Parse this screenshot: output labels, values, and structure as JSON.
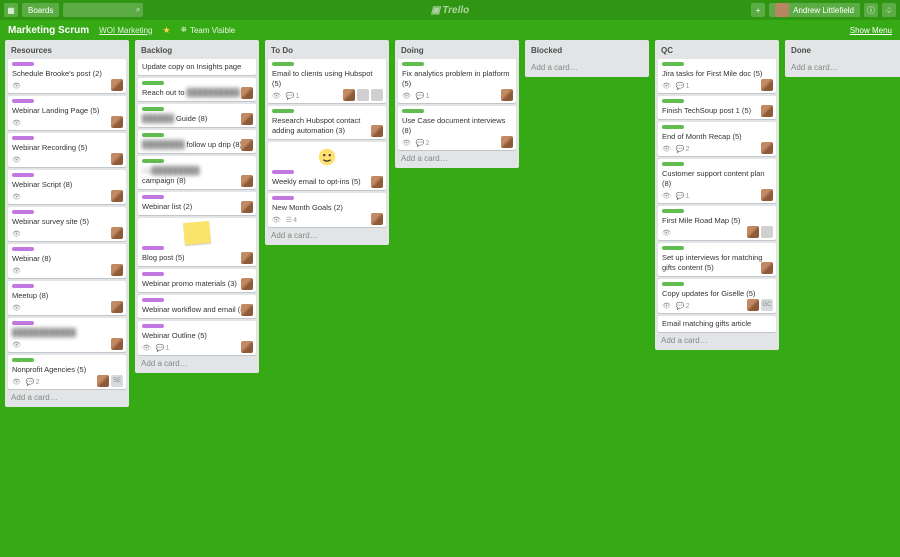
{
  "topbar": {
    "boards_label": "Boards",
    "logo_text": "Trello",
    "user_name": "Andrew Littlefield"
  },
  "board_header": {
    "title": "Marketing Scrum",
    "team": "WOI Marketing",
    "visibility": "Team Visible",
    "show_menu": "Show Menu"
  },
  "add_card_text": "Add a card…",
  "lists": {
    "resources": {
      "name": "Resources",
      "cards": [
        {
          "labels": [
            "purple"
          ],
          "title": "Schedule Brooke's post (2)",
          "watch": true,
          "avatars": [
            "p"
          ]
        },
        {
          "labels": [
            "purple"
          ],
          "title": "Webinar Landing Page (5)",
          "watch": true,
          "avatars": [
            "p"
          ]
        },
        {
          "labels": [
            "purple"
          ],
          "title": "Webinar Recording (5)",
          "watch": true,
          "avatars": [
            "p"
          ]
        },
        {
          "labels": [
            "purple"
          ],
          "title": "Webinar Script (8)",
          "watch": true,
          "avatars": [
            "p"
          ]
        },
        {
          "labels": [
            "purple"
          ],
          "title": "Webinar survey site (5)",
          "watch": true,
          "avatars": [
            "p"
          ]
        },
        {
          "labels": [
            "purple"
          ],
          "title": "Webinar (8)",
          "watch": true,
          "avatars": [
            "p"
          ]
        },
        {
          "labels": [
            "purple"
          ],
          "title": "Meetup (8)",
          "watch": true,
          "avatars": [
            "p"
          ]
        },
        {
          "labels": [
            "purple"
          ],
          "title_blur": true,
          "title": "████████████",
          "watch": true,
          "avatars": [
            "p"
          ]
        },
        {
          "labels": [
            "green"
          ],
          "title": "Nonprofit Agencies (5)",
          "watch": true,
          "comments": 2,
          "avatars": [
            "p",
            "SE"
          ]
        }
      ]
    },
    "backlog": {
      "name": "Backlog",
      "cards": [
        {
          "title": "Update copy on Insights page"
        },
        {
          "labels": [
            "green"
          ],
          "title": "Reach out to ",
          "title_blur_suffix": "██████████",
          "avatars": [
            "p"
          ]
        },
        {
          "labels": [
            "green"
          ],
          "title_blur_prefix": "██████",
          "title": " Guide (8)",
          "avatars": [
            "p"
          ]
        },
        {
          "labels": [
            "green"
          ],
          "title_blur_prefix": "████████",
          "title": " follow up drip (8)",
          "avatars": [
            "p"
          ]
        },
        {
          "labels": [
            "green"
          ],
          "title_blur_prefix": "Ca█████████",
          "title": "",
          "subtitle": "campaign (8)",
          "avatars": [
            "p"
          ]
        },
        {
          "labels": [
            "purple"
          ],
          "title": "Webinar list (2)",
          "avatars": [
            "p"
          ]
        },
        {
          "sticker": "yellow-note",
          "labels": [
            "purple"
          ],
          "title": "Blog post (5)",
          "avatars": [
            "p"
          ]
        },
        {
          "labels": [
            "purple"
          ],
          "title": "Webinar promo materials (3)",
          "avatars": [
            "p"
          ]
        },
        {
          "labels": [
            "purple"
          ],
          "title": "Webinar workflow and email (8)",
          "avatars": [
            "p"
          ]
        },
        {
          "labels": [
            "purple"
          ],
          "title": "Webinar Outline (5)",
          "watch": true,
          "comments": 1,
          "avatars": [
            "p"
          ]
        }
      ]
    },
    "todo": {
      "name": "To Do",
      "cards": [
        {
          "labels": [
            "green"
          ],
          "title": "Email to clients using Hubspot (5)",
          "watch": true,
          "comments": 1,
          "avatars": [
            "p",
            "b",
            "b"
          ]
        },
        {
          "labels": [
            "green"
          ],
          "title": "Research Hubspot contact adding automation (3)",
          "avatars": [
            "p"
          ]
        },
        {
          "sticker": "star-face",
          "labels": [
            "purple"
          ],
          "title": "Weekly email to opt-ins (5)",
          "avatars": [
            "p"
          ]
        },
        {
          "labels": [
            "purple"
          ],
          "title": "New Month Goals (2)",
          "watch": true,
          "extra": 4,
          "avatars": [
            "p"
          ]
        }
      ]
    },
    "doing": {
      "name": "Doing",
      "cards": [
        {
          "labels": [
            "green"
          ],
          "title": "Fix analytics problem in platform (5)",
          "watch": true,
          "comments": 1,
          "avatars": [
            "p"
          ]
        },
        {
          "labels": [
            "green"
          ],
          "title": "Use Case document interviews (8)",
          "watch": true,
          "comments": 2,
          "avatars": [
            "p"
          ]
        }
      ]
    },
    "blocked": {
      "name": "Blocked",
      "cards": []
    },
    "qc": {
      "name": "QC",
      "cards": [
        {
          "labels": [
            "green"
          ],
          "title": "Jira tasks for First Mile doc (5)",
          "watch": true,
          "comments": 1,
          "avatars": [
            "p"
          ]
        },
        {
          "labels": [
            "green"
          ],
          "title": "Finish TechSoup post 1 (5)",
          "avatars": [
            "p"
          ]
        },
        {
          "labels": [
            "green"
          ],
          "title": "End of Month Recap (5)",
          "watch": true,
          "comments": 2,
          "avatars": [
            "p"
          ]
        },
        {
          "labels": [
            "green"
          ],
          "title": "Customer support content plan (8)",
          "watch": true,
          "comments": 1,
          "avatars": [
            "p"
          ]
        },
        {
          "labels": [
            "green"
          ],
          "title": "First Mile Road Map (5)",
          "watch": true,
          "avatars": [
            "p",
            "b"
          ]
        },
        {
          "labels": [
            "green"
          ],
          "title": "Set up interviews for matching gifts content (5)",
          "avatars": [
            "p"
          ]
        },
        {
          "labels": [
            "green"
          ],
          "title": "Copy updates for Giselle (5)",
          "watch": true,
          "comments": 2,
          "avatars": [
            "p",
            "GC"
          ]
        },
        {
          "title": "Email matching gifts article"
        }
      ]
    },
    "done": {
      "name": "Done",
      "cards": []
    }
  }
}
